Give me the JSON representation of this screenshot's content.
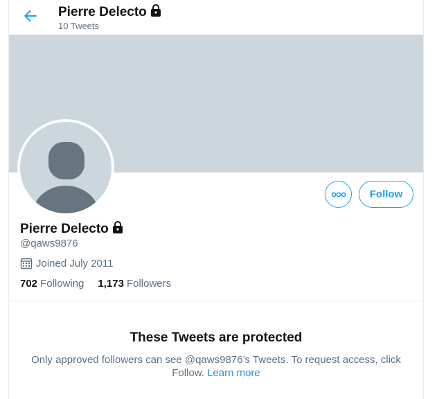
{
  "header": {
    "title": "Pierre Delecto",
    "tweet_count": "10 Tweets"
  },
  "profile": {
    "name": "Pierre Delecto",
    "handle": "@qaws9876",
    "joined": "Joined July 2011",
    "following_count": "702",
    "following_label": "Following",
    "followers_count": "1,173",
    "followers_label": "Followers"
  },
  "actions": {
    "follow_label": "Follow"
  },
  "protected": {
    "title": "These Tweets are protected",
    "text_before": "Only approved followers can see @qaws9876’s Tweets. To request access, click Follow.",
    "learn_more": "Learn more"
  },
  "colors": {
    "accent": "#1da1f2",
    "banner": "#ccd6dd",
    "secondary_text": "#5b7083"
  },
  "icons": [
    "back-arrow-icon",
    "lock-icon",
    "more-options-icon",
    "calendar-icon",
    "default-avatar-icon"
  ]
}
